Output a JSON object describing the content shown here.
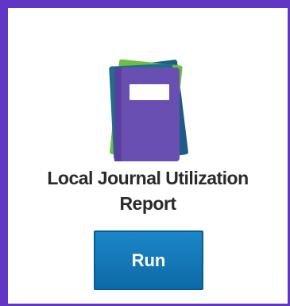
{
  "report": {
    "icon": "journal-books-icon",
    "title_line1": "Local Journal Utilization",
    "title_line2": "Report",
    "run_label": "Run"
  },
  "colors": {
    "frame": "#6236c4",
    "book_front": "#6a4fb2",
    "book_back": "#1e5b86",
    "book_middle": "#6fbe44",
    "button": "#1378b8",
    "title_text": "#2a2a2a"
  }
}
